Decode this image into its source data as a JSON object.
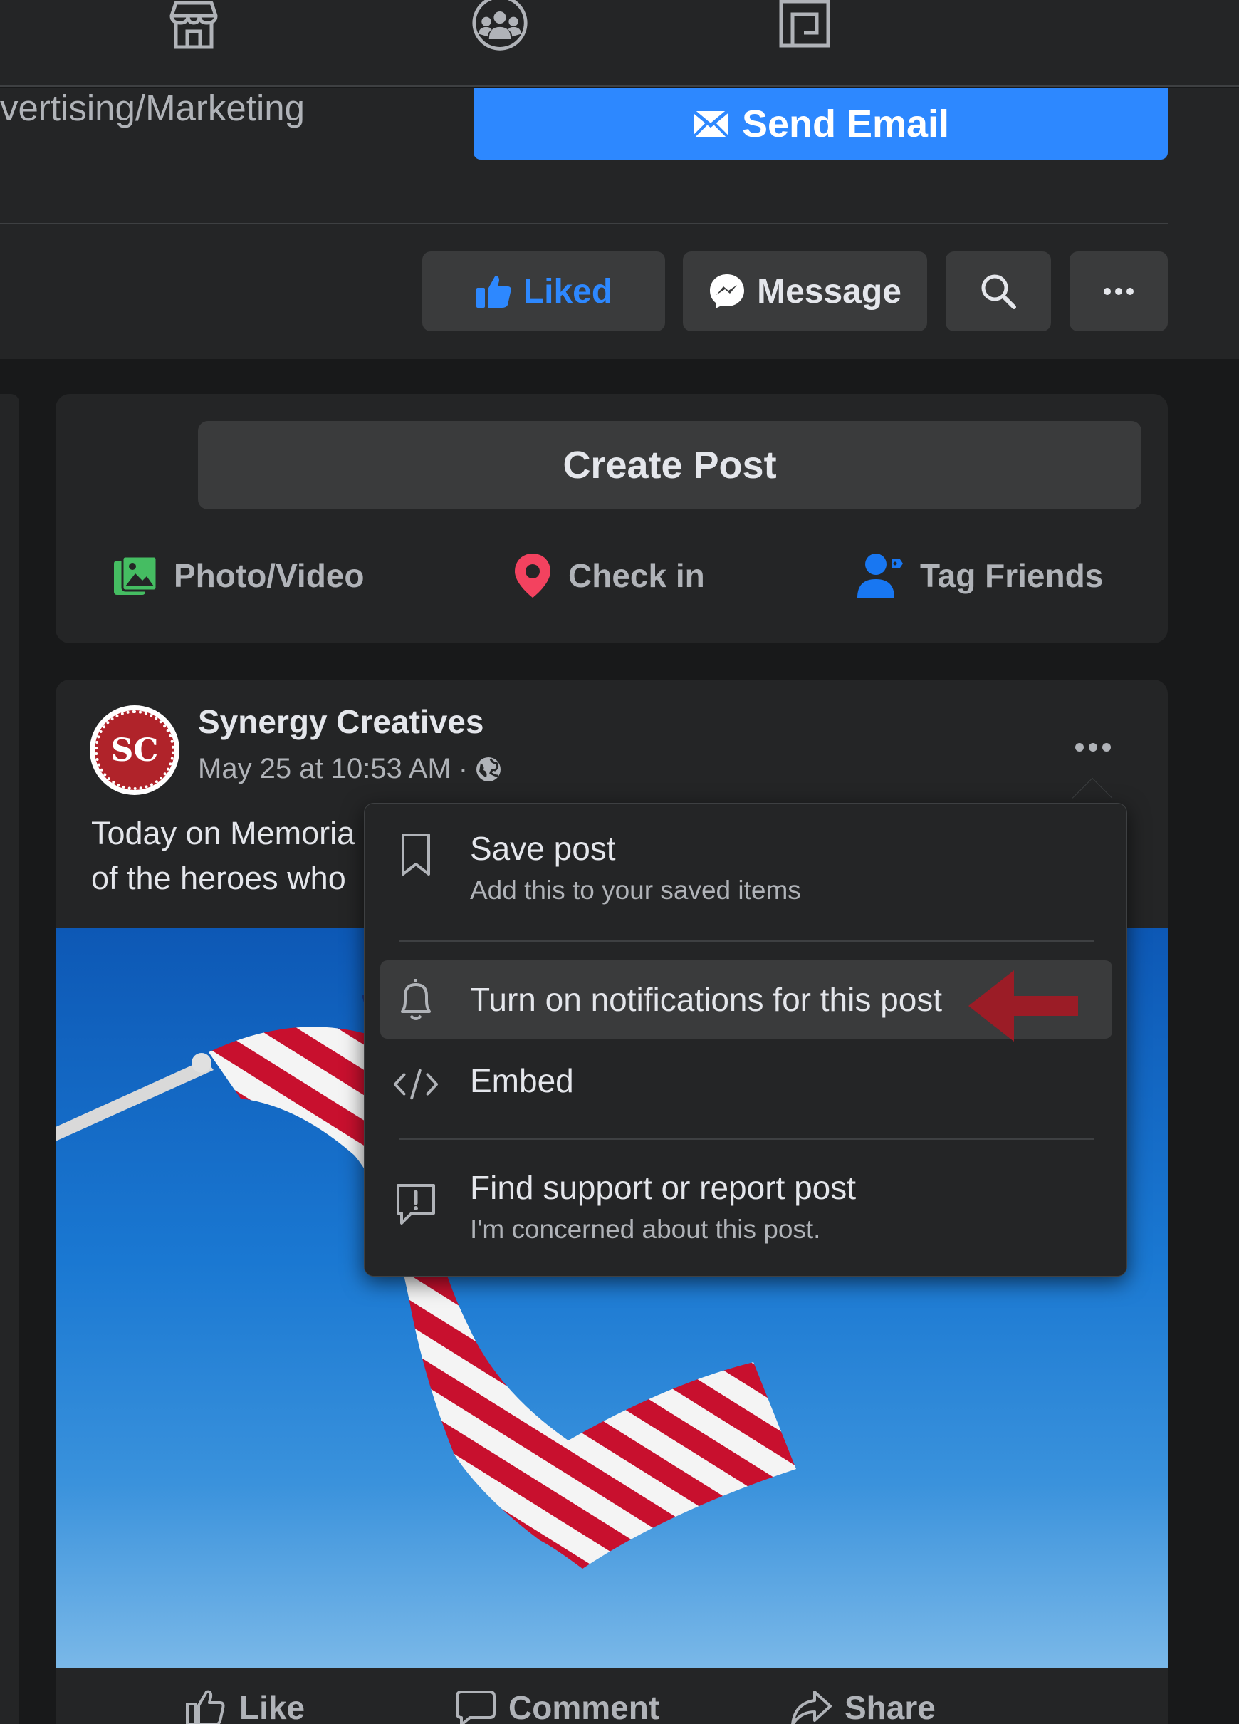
{
  "top_nav": {
    "icons": [
      "shop-icon",
      "groups-icon",
      "gaming-icon"
    ]
  },
  "page_header": {
    "category": "vertising/Marketing",
    "send_email_label": "Send Email",
    "actions": {
      "liked_label": "Liked",
      "message_label": "Message"
    }
  },
  "composer": {
    "create_post_label": "Create Post",
    "photo_video_label": "Photo/Video",
    "check_in_label": "Check in",
    "tag_friends_label": "Tag Friends"
  },
  "post": {
    "author": "Synergy Creatives",
    "avatar_initials": "SC",
    "timestamp": "May 25 at 10:53 AM",
    "separator": "·",
    "text_line1": "Today on Memoria",
    "text_line2": "of the heroes who",
    "actions": {
      "like_label": "Like",
      "comment_label": "Comment",
      "share_label": "Share"
    }
  },
  "post_menu": {
    "items": [
      {
        "title": "Save post",
        "subtitle": "Add this to your saved items",
        "icon": "bookmark-icon"
      },
      {
        "title": "Turn on notifications for this post",
        "subtitle": "",
        "icon": "bell-icon",
        "highlighted": true
      },
      {
        "title": "Embed",
        "subtitle": "",
        "icon": "code-icon"
      },
      {
        "title": "Find support or report post",
        "subtitle": "I'm concerned about this post.",
        "icon": "report-icon"
      }
    ]
  },
  "colors": {
    "background": "#18191a",
    "surface": "#242526",
    "button": "#3a3b3c",
    "primary": "#2d88ff",
    "annotation_arrow": "#9b1c26"
  }
}
